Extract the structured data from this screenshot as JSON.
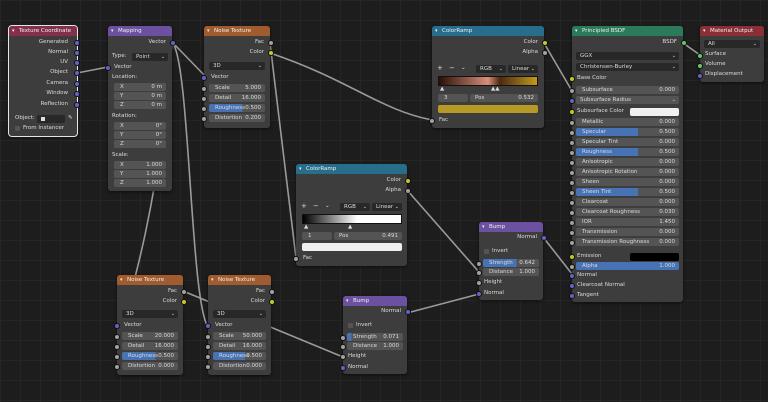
{
  "tex_coord": {
    "title": "Texture Coordinate",
    "outputs": [
      "Generated",
      "Normal",
      "UV",
      "Object",
      "Camera",
      "Window",
      "Reflection"
    ],
    "object_label": "Object:",
    "from_instancer": "From Instancer"
  },
  "mapping": {
    "title": "Mapping",
    "out_vector": "Vector",
    "type_label": "Type:",
    "type_value": "Point",
    "in_vector": "Vector",
    "location_label": "Location:",
    "rotation_label": "Rotation:",
    "scale_label": "Scale:",
    "location": [
      {
        "axis": "X",
        "value": "0 m"
      },
      {
        "axis": "Y",
        "value": "0 m"
      },
      {
        "axis": "Z",
        "value": "0 m"
      }
    ],
    "rotation": [
      {
        "axis": "X",
        "value": "0°"
      },
      {
        "axis": "Y",
        "value": "0°"
      },
      {
        "axis": "Z",
        "value": "0°"
      }
    ],
    "scale": [
      {
        "axis": "X",
        "value": "1.000"
      },
      {
        "axis": "Y",
        "value": "1.000"
      },
      {
        "axis": "Z",
        "value": "1.000"
      }
    ]
  },
  "noise1": {
    "title": "Noise Texture",
    "fac": "Fac",
    "color": "Color",
    "dim": "3D",
    "vector": "Vector",
    "fields": [
      {
        "label": "Scale",
        "value": "5.000"
      },
      {
        "label": "Detail",
        "value": "16.000"
      },
      {
        "label": "Roughness",
        "value": "0.500"
      },
      {
        "label": "Distortion",
        "value": "0.200"
      }
    ]
  },
  "ramp1": {
    "title": "ColorRamp",
    "color": "Color",
    "alpha": "Alpha",
    "plus": "+",
    "minus": "−",
    "mode": "RGB",
    "interp": "Linear",
    "index": "3",
    "pos_label": "Pos",
    "pos_value": "0.532",
    "fac": "Fac"
  },
  "ramp2": {
    "title": "ColorRamp",
    "color": "Color",
    "alpha": "Alpha",
    "plus": "+",
    "minus": "−",
    "mode": "RGB",
    "interp": "Linear",
    "index": "1",
    "pos_label": "Pos",
    "pos_value": "0.491",
    "fac": "Fac"
  },
  "bsdf": {
    "title": "Principled BSDF",
    "out": "BSDF",
    "distribution": "GGX",
    "subsurface_method": "Christensen-Burley",
    "base_color": "Base Color",
    "rows1": [
      {
        "label": "Subsurface",
        "value": "0.000",
        "style": "plain"
      }
    ],
    "subsurface_radius": "Subsurface Radius",
    "subsurface_color": "Subsurface Color",
    "rows2": [
      {
        "label": "Metallic",
        "value": "0.000",
        "style": "plain"
      },
      {
        "label": "Specular",
        "value": "0.500",
        "style": "half"
      },
      {
        "label": "Specular Tint",
        "value": "0.000",
        "style": "plain"
      },
      {
        "label": "Roughness",
        "value": "0.500",
        "style": "half"
      },
      {
        "label": "Anisotropic",
        "value": "0.000",
        "style": "plain"
      },
      {
        "label": "Anisotropic Rotation",
        "value": "0.000",
        "style": "plain"
      },
      {
        "label": "Sheen",
        "value": "0.000",
        "style": "plain"
      },
      {
        "label": "Sheen Tint",
        "value": "0.500",
        "style": "half"
      },
      {
        "label": "Clearcoat",
        "value": "0.000",
        "style": "plain"
      },
      {
        "label": "Clearcoat Roughness",
        "value": "0.030",
        "style": "plain"
      },
      {
        "label": "IOR",
        "value": "1.450",
        "style": "plain"
      },
      {
        "label": "Transmission",
        "value": "0.000",
        "style": "plain"
      },
      {
        "label": "Transmission Roughness",
        "value": "0.000",
        "style": "plain"
      }
    ],
    "emission": "Emission",
    "alpha_label": "Alpha",
    "alpha_value": "1.000",
    "normal": "Normal",
    "clearcoat_normal": "Clearcoat Normal",
    "tangent": "Tangent"
  },
  "output": {
    "title": "Material Output",
    "target": "All",
    "surface": "Surface",
    "volume": "Volume",
    "displacement": "Displacement"
  },
  "bump1": {
    "title": "Bump",
    "normal_out": "Normal",
    "invert": "Invert",
    "strength_label": "Strength",
    "strength_value": "0.642",
    "distance_label": "Distance",
    "distance_value": "1.000",
    "height": "Height",
    "normal_in": "Normal"
  },
  "bump2": {
    "title": "Bump",
    "normal_out": "Normal",
    "invert": "Invert",
    "strength_label": "Strength",
    "strength_value": "0.071",
    "distance_label": "Distance",
    "distance_value": "1.000",
    "height": "Height",
    "normal_in": "Normal"
  },
  "noise2": {
    "title": "Noise Texture",
    "fac": "Fac",
    "color": "Color",
    "dim": "3D",
    "vector": "Vector",
    "fields": [
      {
        "label": "Scale",
        "value": "20.000"
      },
      {
        "label": "Detail",
        "value": "16.000"
      },
      {
        "label": "Roughness",
        "value": "0.500"
      },
      {
        "label": "Distortion",
        "value": "0.000"
      }
    ]
  },
  "noise3": {
    "title": "Noise Texture",
    "fac": "Fac",
    "color": "Color",
    "dim": "3D",
    "vector": "Vector",
    "fields": [
      {
        "label": "Scale",
        "value": "50.000"
      },
      {
        "label": "Detail",
        "value": "16.000"
      },
      {
        "label": "Roughness",
        "value": "0.500"
      },
      {
        "label": "Distortion",
        "value": "0.000"
      }
    ]
  }
}
